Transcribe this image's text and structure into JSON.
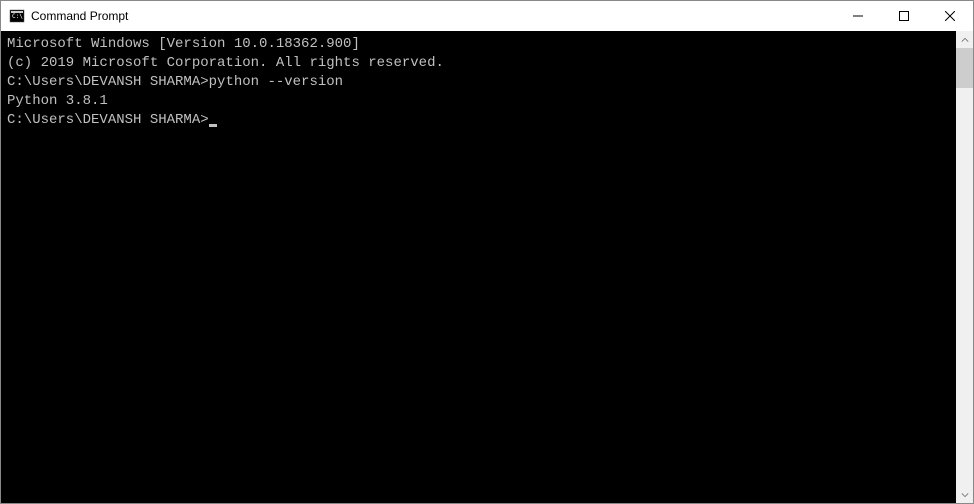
{
  "window": {
    "title": "Command Prompt"
  },
  "terminal": {
    "line1": "Microsoft Windows [Version 10.0.18362.900]",
    "line2": "(c) 2019 Microsoft Corporation. All rights reserved.",
    "blank1": "",
    "prompt1": "C:\\Users\\DEVANSH SHARMA>",
    "command1": "python --version",
    "output1": "Python 3.8.1",
    "blank2": "",
    "prompt2": "C:\\Users\\DEVANSH SHARMA>"
  }
}
